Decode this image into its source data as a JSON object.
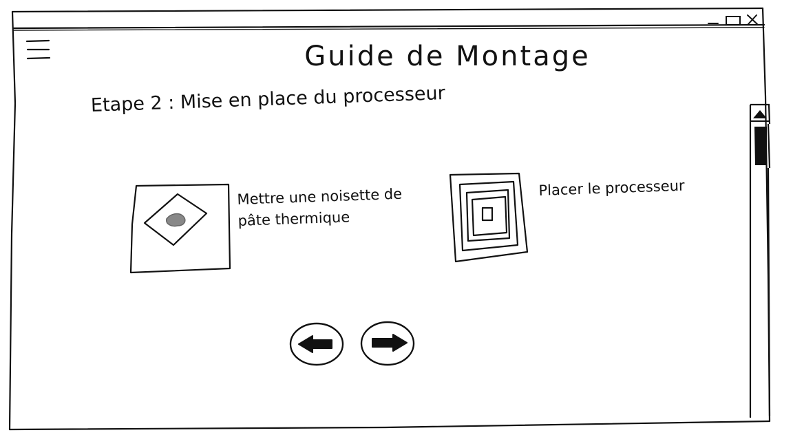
{
  "app": {
    "title": "Guide de Montage"
  },
  "window_controls": {
    "minimize_icon": "minimize-icon",
    "maximize_icon": "maximize-icon",
    "close_icon": "close-icon"
  },
  "menu": {
    "icon": "hamburger-menu-icon"
  },
  "step": {
    "title": "Etape 2 : Mise en place du processeur",
    "instructions": [
      {
        "text": "Mettre une noisette de pâte thermique",
        "image_icon": "thermal-paste-icon"
      },
      {
        "text": "Placer le processeur",
        "image_icon": "processor-icon"
      }
    ]
  },
  "navigation": {
    "previous_icon": "arrow-left-icon",
    "next_icon": "arrow-right-icon"
  },
  "scrollbar": {
    "up_icon": "triangle-up-icon"
  },
  "colors": {
    "ink": "#111111",
    "paste": "#888888",
    "background": "#ffffff"
  }
}
